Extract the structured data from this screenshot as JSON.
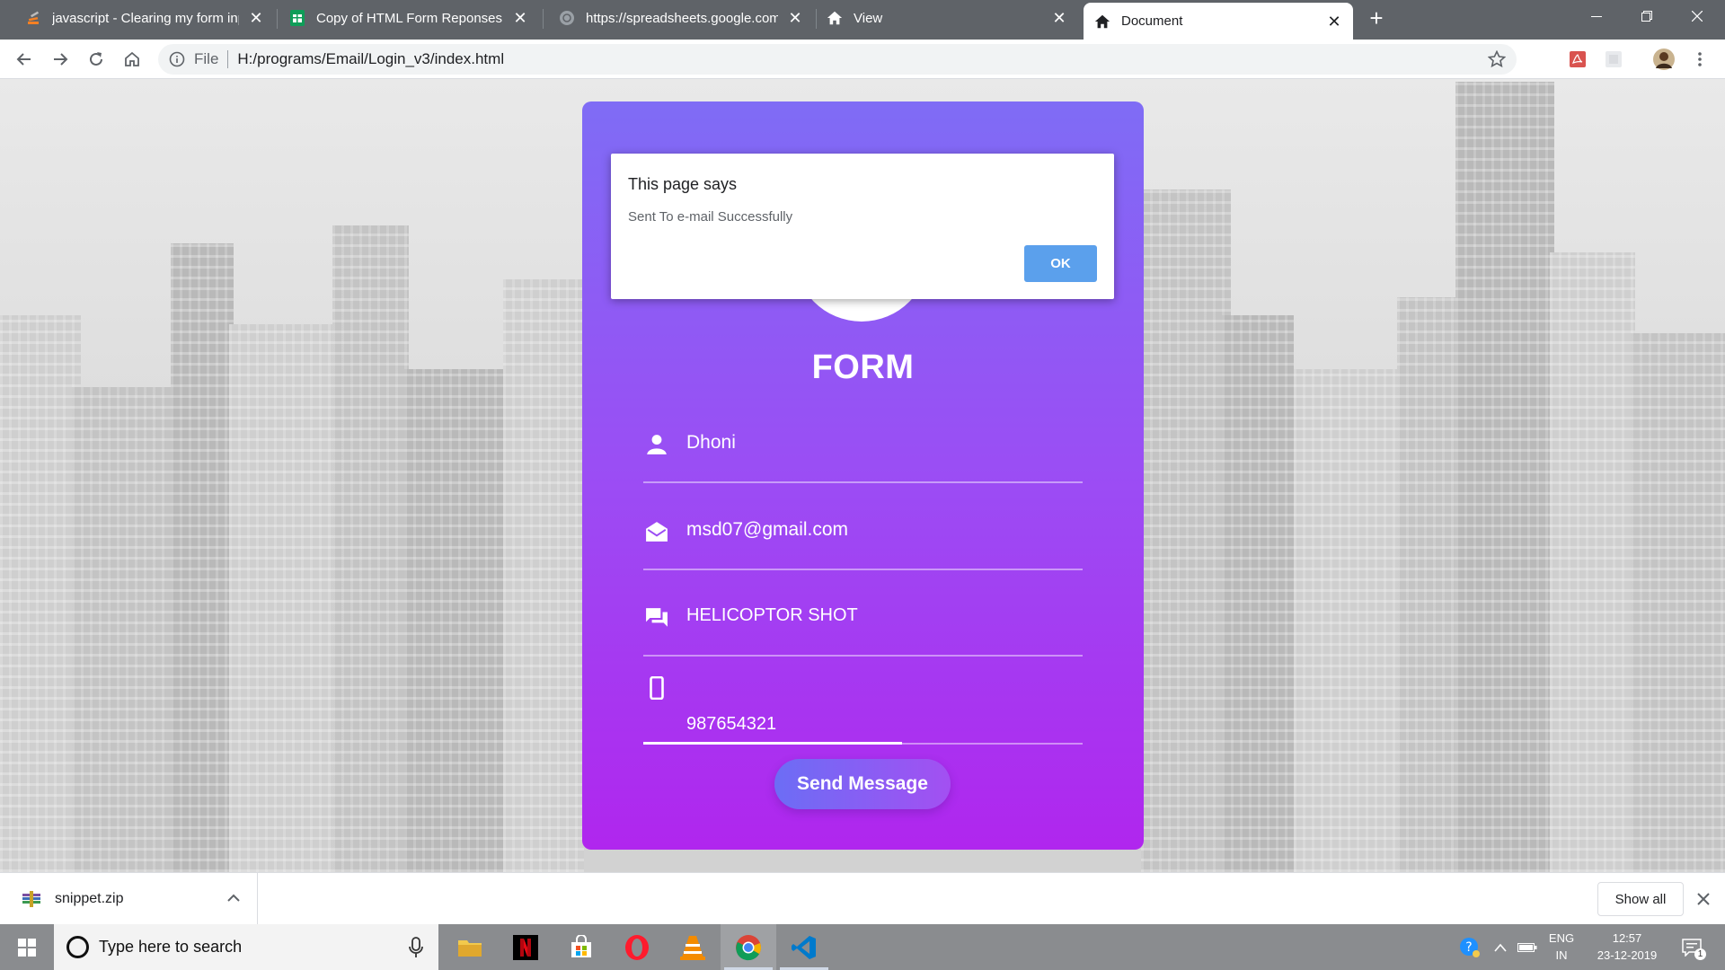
{
  "browser": {
    "tabs": [
      {
        "title": "javascript - Clearing my form inputs"
      },
      {
        "title": "Copy of HTML Form Reponses - Google Sheets"
      },
      {
        "title": "https://spreadsheets.google.com"
      },
      {
        "title": "View"
      },
      {
        "title": "Document"
      }
    ],
    "url_scheme": "File",
    "url": "H:/programs/Email/Login_v3/index.html"
  },
  "form": {
    "title": "FORM",
    "name_value": "Dhoni",
    "email_value": "msd07@gmail.com",
    "message_value": "HELICOPTOR SHOT",
    "phone_value": "987654321",
    "submit_label": "Send Message"
  },
  "alert": {
    "title": "This page says",
    "message": "Sent To e-mail Successfully",
    "ok_label": "OK"
  },
  "downloads": {
    "file_name": "snippet.zip",
    "show_all_label": "Show all"
  },
  "taskbar": {
    "search_placeholder": "Type here to search",
    "lang_line1": "ENG",
    "lang_line2": "IN",
    "time": "12:57",
    "date": "23-12-2019",
    "notification_count": "1"
  },
  "colors": {
    "card_top": "#7f6cf5",
    "card_bottom": "#b026ee",
    "ok_button": "#5ba0ec",
    "tabstrip": "#5f6368"
  }
}
